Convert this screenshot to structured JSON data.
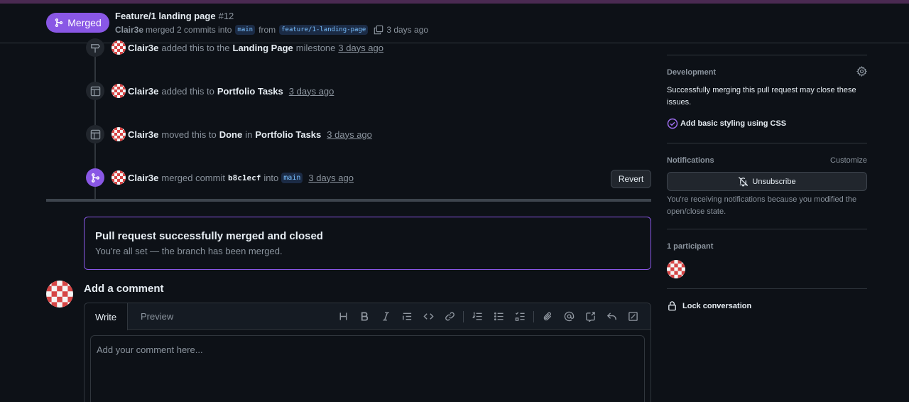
{
  "header": {
    "state_label": "Merged",
    "title": "Feature/1 landing page",
    "number": "#12",
    "author": "Clair3e",
    "merge_text": "merged 2 commits into",
    "base_branch": "main",
    "from_text": "from",
    "head_branch": "feature/1-landing-page",
    "time": "3 days ago"
  },
  "timeline": {
    "milestone": {
      "user": "Clair3e",
      "text1": "added this to the",
      "target": "Landing Page",
      "text2": "milestone",
      "time": "3 days ago"
    },
    "project_add": {
      "user": "Clair3e",
      "text1": "added this to",
      "target": "Portfolio Tasks",
      "time": "3 days ago"
    },
    "project_move": {
      "user": "Clair3e",
      "text1": "moved this to",
      "status": "Done",
      "text2": "in",
      "target": "Portfolio Tasks",
      "time": "3 days ago"
    },
    "merge": {
      "user": "Clair3e",
      "text1": "merged commit",
      "commit": "b8c1ecf",
      "text2": "into",
      "branch": "main",
      "time": "3 days ago",
      "revert_label": "Revert"
    }
  },
  "merged_box": {
    "heading": "Pull request successfully merged and closed",
    "subtext": "You're all set — the branch has been merged."
  },
  "comment": {
    "heading": "Add a comment",
    "tab_write": "Write",
    "tab_preview": "Preview",
    "placeholder": "Add your comment here...",
    "toolbar": [
      "heading-icon",
      "bold-icon",
      "italic-icon",
      "quote-icon",
      "code-icon",
      "link-icon",
      "ordered-list-icon",
      "unordered-list-icon",
      "task-list-icon",
      "attach-icon",
      "mention-icon",
      "reference-icon",
      "reply-icon",
      "fullscreen-icon"
    ]
  },
  "sidebar": {
    "development": {
      "heading": "Development",
      "text": "Successfully merging this pull request may close these issues.",
      "issue": "Add basic styling using CSS"
    },
    "notifications": {
      "heading": "Notifications",
      "customize": "Customize",
      "button": "Unsubscribe",
      "text": "You're receiving notifications because you modified the open/close state."
    },
    "participants": {
      "heading": "1 participant"
    },
    "lock": {
      "label": "Lock conversation"
    }
  },
  "colors": {
    "merged": "#8957e5",
    "bg": "#0d1117",
    "border": "#30363d"
  }
}
